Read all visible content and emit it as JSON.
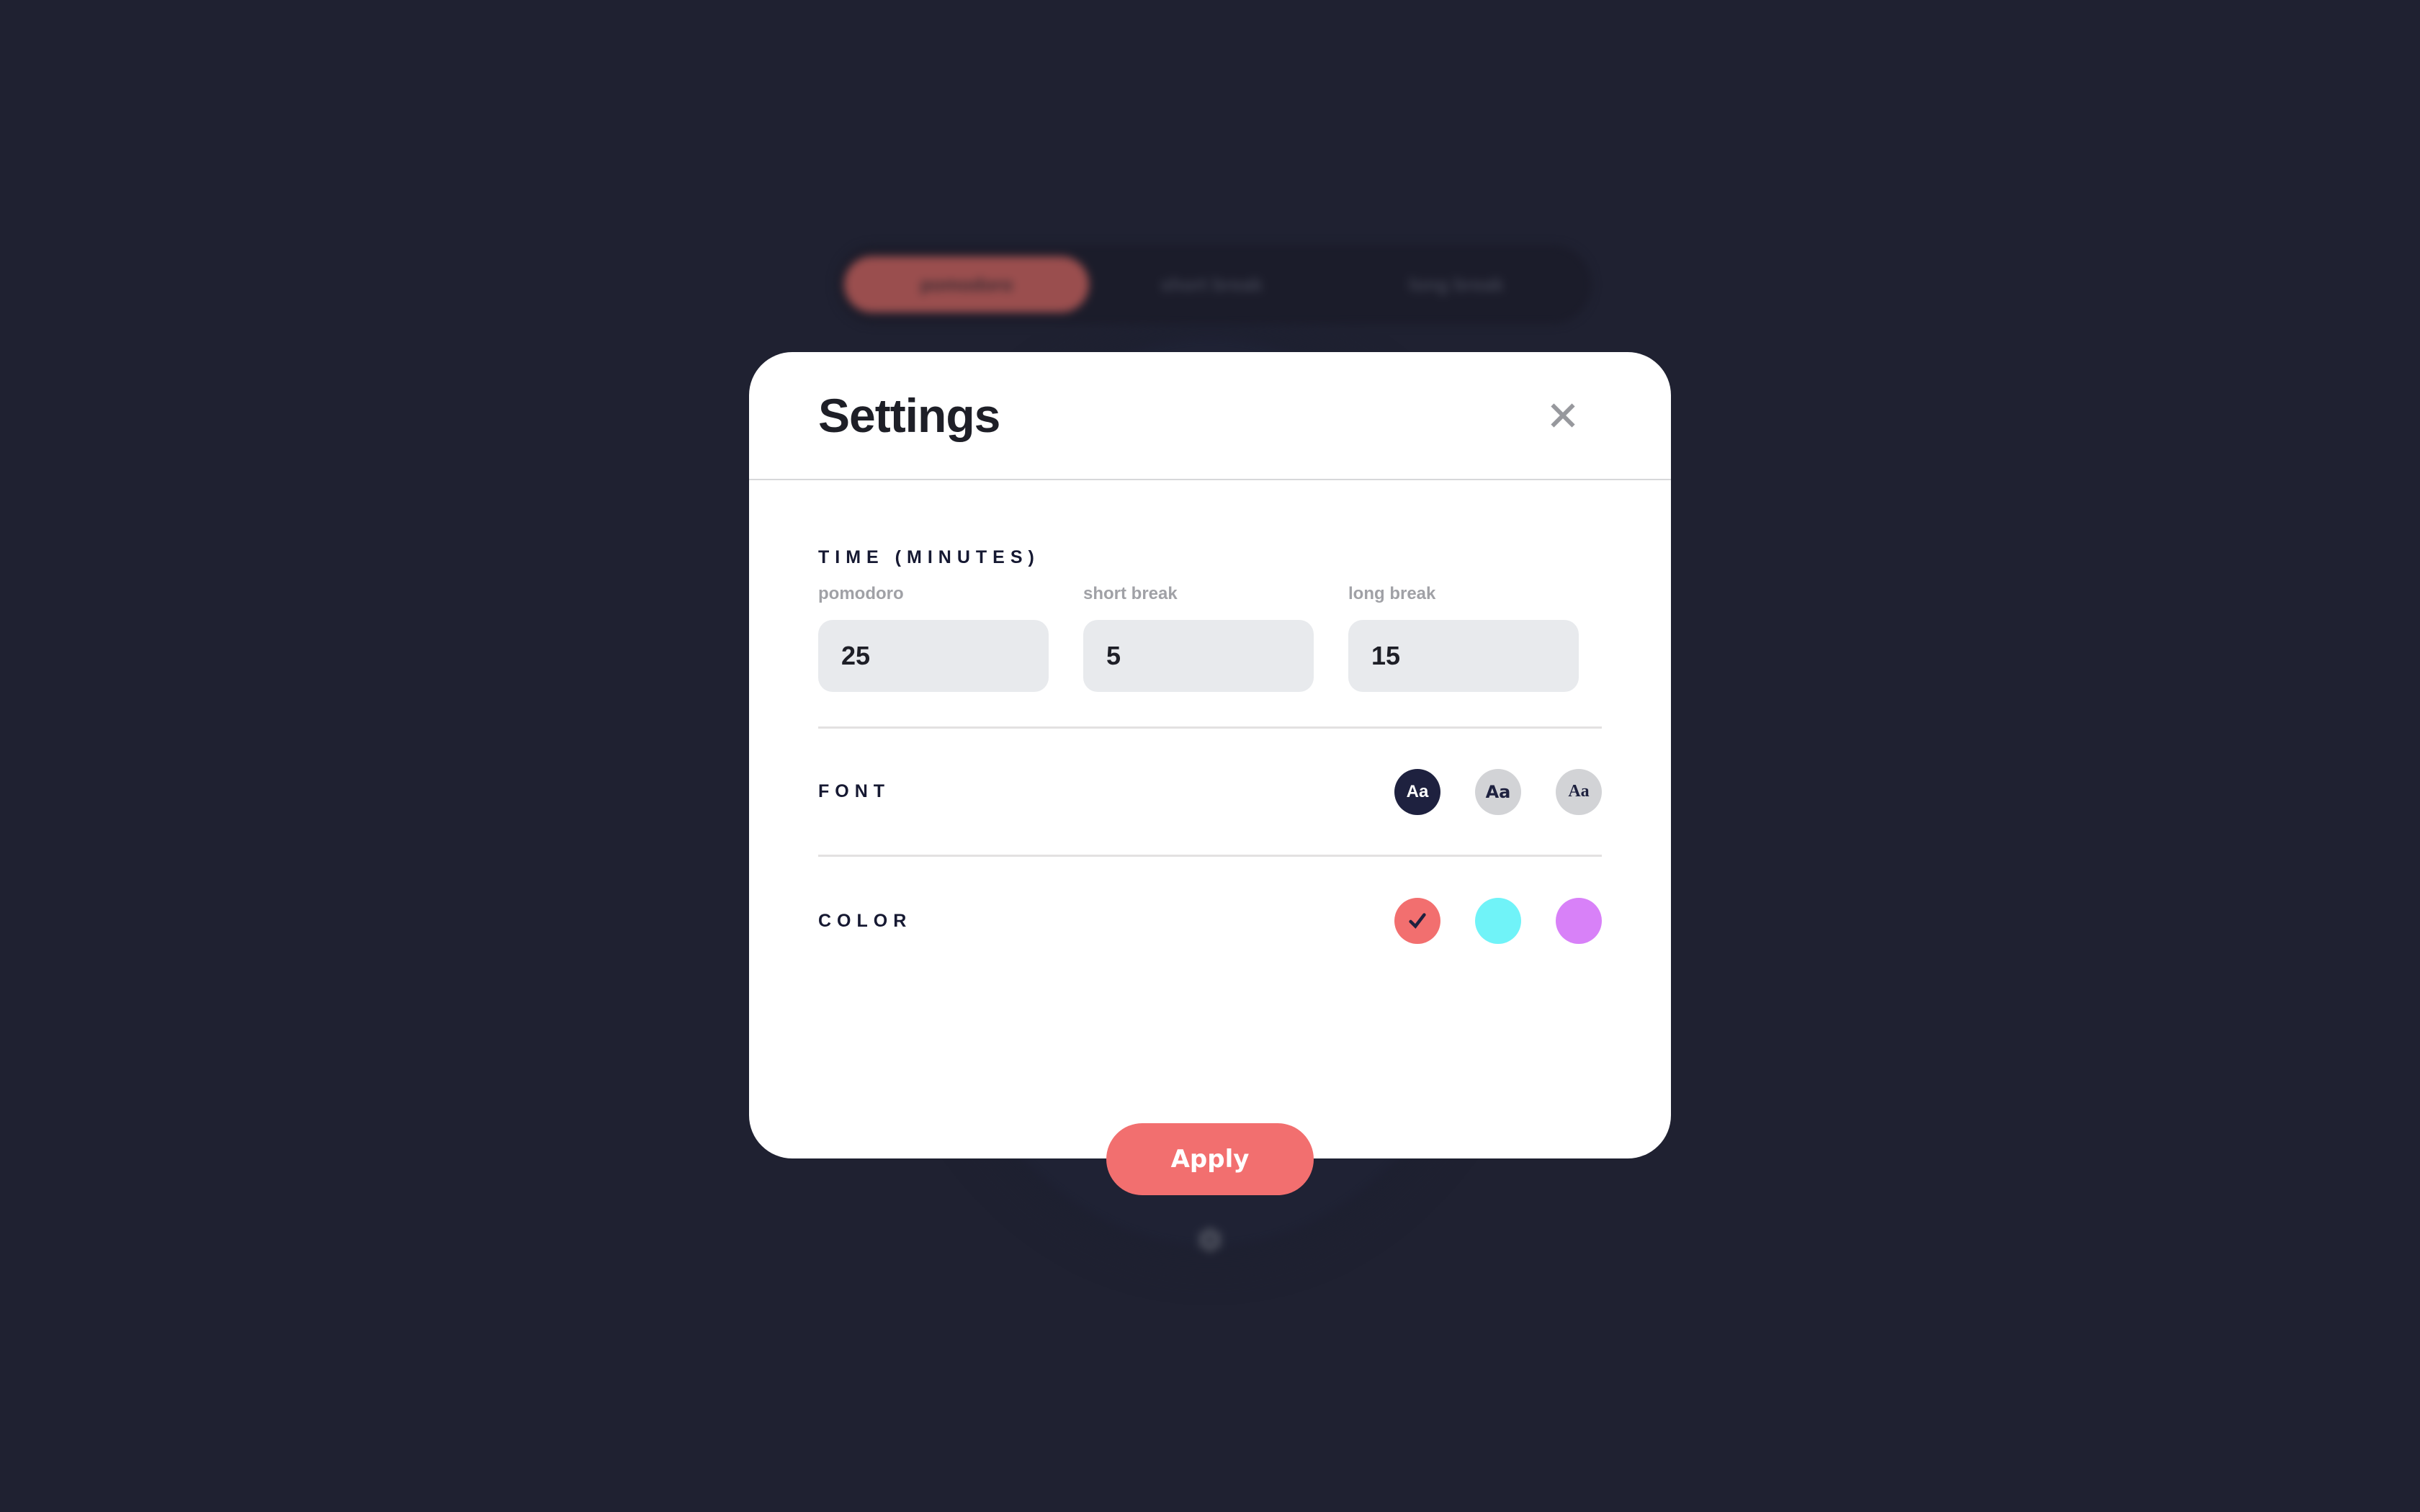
{
  "background_app": {
    "tabs": [
      {
        "label": "pomodoro",
        "active": true
      },
      {
        "label": "short break",
        "active": false
      },
      {
        "label": "long break",
        "active": false
      }
    ],
    "settings_icon": "gear-icon"
  },
  "modal": {
    "title": "Settings",
    "close_icon": "close-icon",
    "time_section": {
      "title": "TIME (MINUTES)",
      "fields": [
        {
          "label": "pomodoro",
          "value": "25"
        },
        {
          "label": "short break",
          "value": "5"
        },
        {
          "label": "long break",
          "value": "15"
        }
      ]
    },
    "font_section": {
      "title": "FONT",
      "options": [
        {
          "label": "Aa",
          "selected": true
        },
        {
          "label": "Aa",
          "selected": false
        },
        {
          "label": "Aa",
          "selected": false
        }
      ]
    },
    "color_section": {
      "title": "COLOR",
      "options": [
        {
          "color": "#f26f6f",
          "selected": true,
          "mark": "✓"
        },
        {
          "color": "#70f3f8",
          "selected": false
        },
        {
          "color": "#d881f8",
          "selected": false
        }
      ]
    },
    "apply_label": "Apply"
  },
  "colors": {
    "background": "#1f2131",
    "accent": "#f26f6f",
    "dark_navy": "#1e213f",
    "input_bg": "#e8eaed"
  }
}
